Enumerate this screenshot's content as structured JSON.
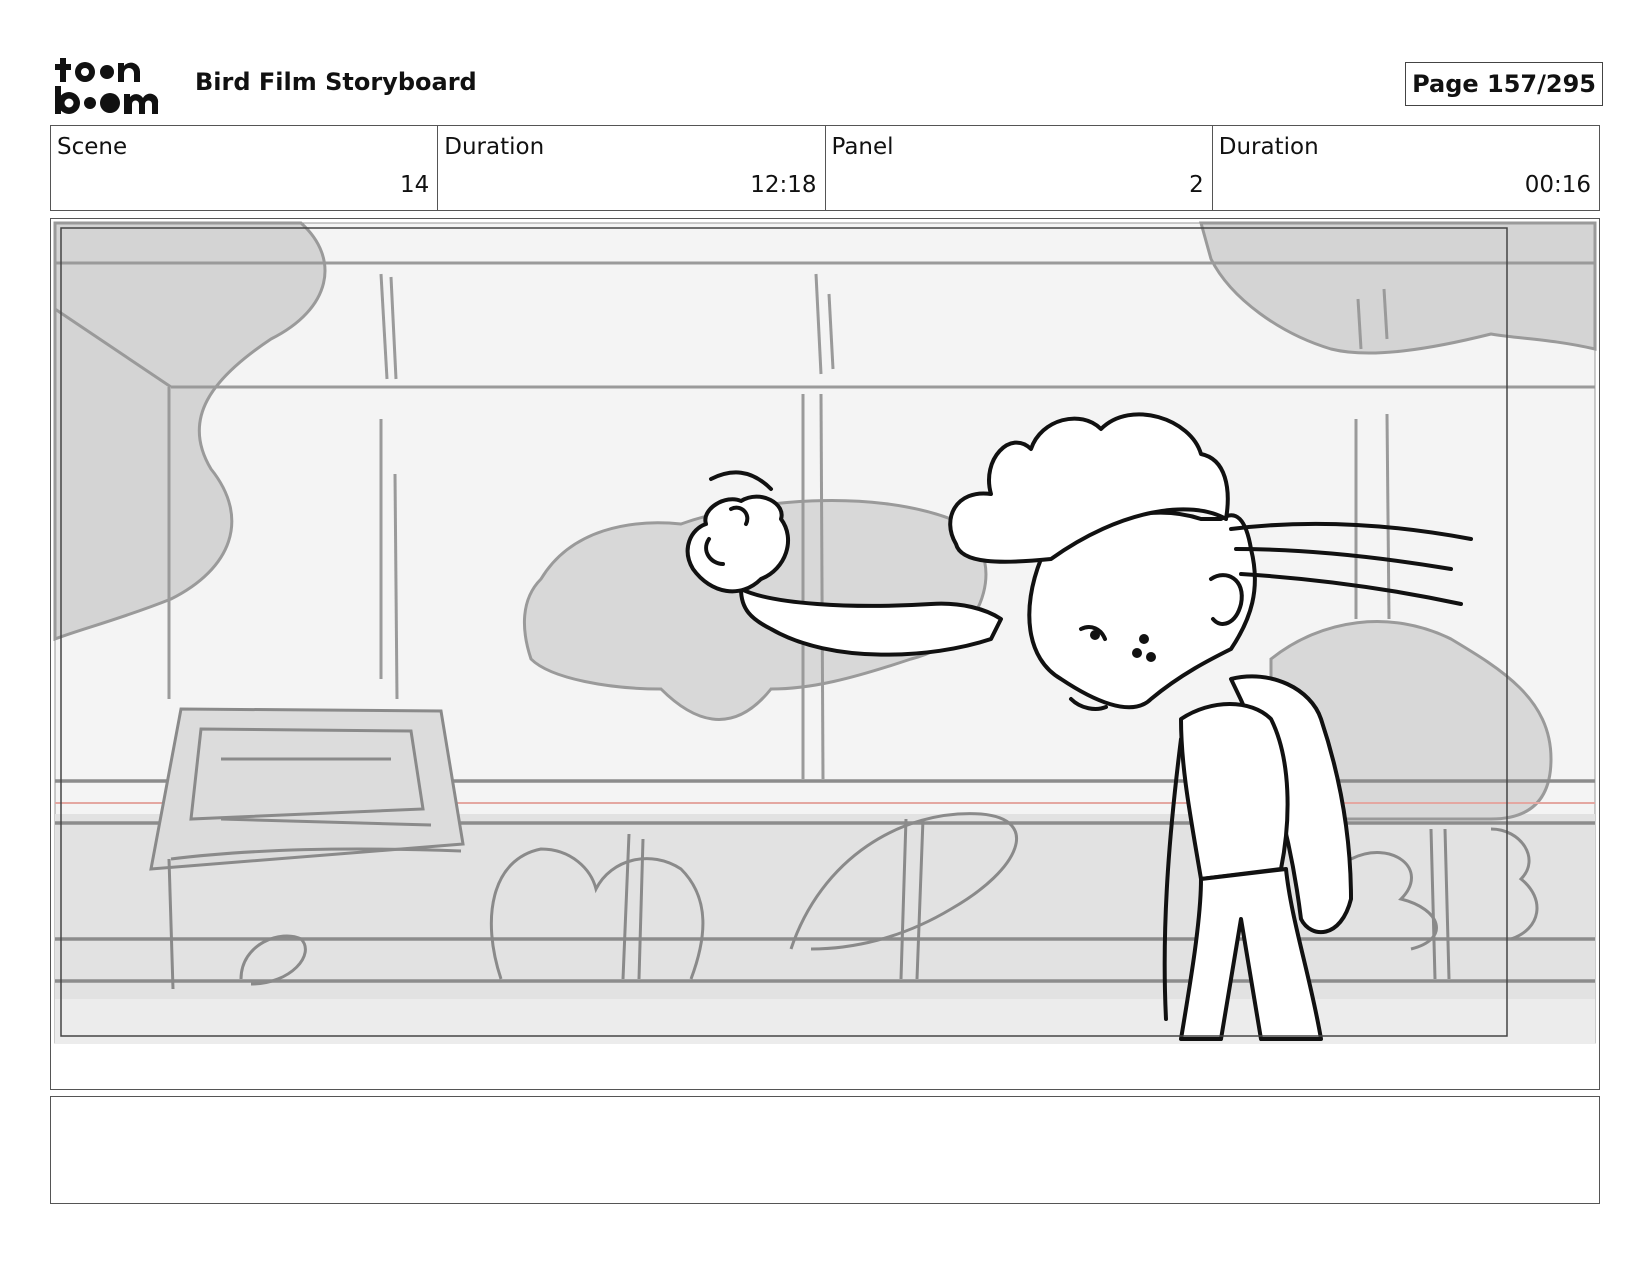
{
  "header": {
    "logo_text": "toon boom",
    "title": "Bird Film Storyboard",
    "page_label": "Page 157/295"
  },
  "info": [
    {
      "label": "Scene",
      "value": "14"
    },
    {
      "label": "Duration",
      "value": "12:18"
    },
    {
      "label": "Panel",
      "value": "2"
    },
    {
      "label": "Duration",
      "value": "00:16"
    }
  ],
  "notes": {
    "text": ""
  }
}
